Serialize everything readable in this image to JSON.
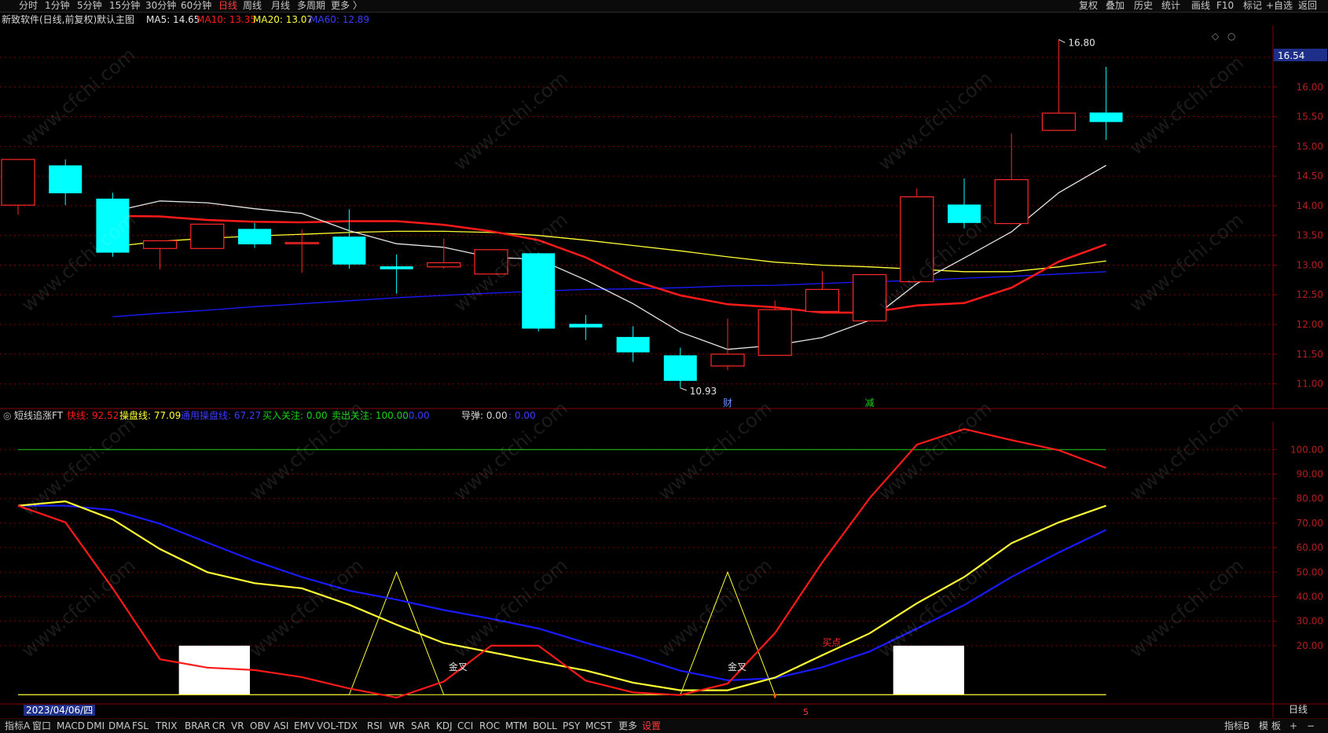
{
  "top_menu": {
    "periods": [
      "分时",
      "1分钟",
      "5分钟",
      "15分钟",
      "30分钟",
      "60分钟",
      "日线",
      "周线",
      "月线",
      "多周期",
      "更多 〉"
    ],
    "active_period": "日线",
    "right_items": [
      "复权",
      "叠加",
      "历史",
      "统计",
      "画线",
      "F10",
      "标记",
      "+自选",
      "返回"
    ]
  },
  "main_info": {
    "title": "新致软件(日线,前复权)",
    "template": "默认主图",
    "ma5": "MA5: 14.65",
    "ma10": "MA10: 13.35",
    "ma20": "MA20: 13.07",
    "ma60": "MA60: 12.89"
  },
  "sub_info": {
    "title": "短线追涨FT",
    "fast": "快线: 92.52",
    "control": "操盘线: 77.09",
    "general": "通用操盘线: 67.27",
    "buy_watch": "买入关注: 0.00",
    "sell_watch": "卖出关注: 100.00",
    "extra1": ": 0.00",
    "guide": "导弹: 0.00",
    "extra2": ": 0.00"
  },
  "colors": {
    "up": "#ff2828",
    "down": "#00ffff",
    "ma5": "#e6e6e6",
    "ma10": "#ff1a1a",
    "ma20": "#ffff33",
    "ma60": "#1a1aff",
    "grid": "#7a0000",
    "fast": "#ff1a1a",
    "control": "#ffff33",
    "general": "#1a1aff",
    "upper_line": "#19d219"
  },
  "current_price_tag": "16.54",
  "date_label": "2023/04/06/四",
  "watermark": "www.cfchi.com",
  "chart_data": [
    {
      "type": "candlestick",
      "name": "price",
      "y_ticks": [
        16.5,
        16.0,
        15.5,
        15.0,
        14.5,
        14.0,
        13.5,
        13.0,
        12.5,
        12.0,
        11.5,
        11.0
      ],
      "y_tick_labels": [
        "16.50",
        "16.00",
        "15.50",
        "15.00",
        "14.50",
        "14.00",
        "13.50",
        "13.00",
        "12.50",
        "12.00",
        "11.50",
        "11.00"
      ],
      "ylim": [
        10.69,
        16.91
      ],
      "candles": [
        {
          "o": 14.01,
          "h": 14.43,
          "l": 13.85,
          "c": 14.78
        },
        {
          "o": 14.68,
          "h": 14.78,
          "l": 14.01,
          "c": 14.21
        },
        {
          "o": 14.12,
          "h": 14.22,
          "l": 13.14,
          "c": 13.21
        },
        {
          "o": 13.28,
          "h": 13.41,
          "l": 12.93,
          "c": 13.41
        },
        {
          "o": 13.28,
          "h": 13.69,
          "l": 13.28,
          "c": 13.69
        },
        {
          "o": 13.61,
          "h": 13.71,
          "l": 13.29,
          "c": 13.35
        },
        {
          "o": 13.38,
          "h": 13.6,
          "l": 12.87,
          "c": 13.38
        },
        {
          "o": 13.48,
          "h": 13.94,
          "l": 12.94,
          "c": 13.01
        },
        {
          "o": 12.98,
          "h": 13.18,
          "l": 12.52,
          "c": 12.93
        },
        {
          "o": 12.97,
          "h": 13.45,
          "l": 12.94,
          "c": 13.04
        },
        {
          "o": 12.85,
          "h": 13.26,
          "l": 12.85,
          "c": 13.26
        },
        {
          "o": 13.2,
          "h": 13.21,
          "l": 11.88,
          "c": 11.93
        },
        {
          "o": 12.01,
          "h": 12.16,
          "l": 11.74,
          "c": 11.95
        },
        {
          "o": 11.79,
          "h": 11.97,
          "l": 11.37,
          "c": 11.53
        },
        {
          "o": 11.48,
          "h": 11.61,
          "l": 10.93,
          "c": 11.05
        },
        {
          "o": 11.3,
          "h": 12.1,
          "l": 11.23,
          "c": 11.5
        },
        {
          "o": 11.48,
          "h": 12.4,
          "l": 11.48,
          "c": 12.25
        },
        {
          "o": 12.22,
          "h": 12.9,
          "l": 12.22,
          "c": 12.59
        },
        {
          "o": 12.06,
          "h": 12.83,
          "l": 12.06,
          "c": 12.84
        },
        {
          "o": 12.72,
          "h": 14.29,
          "l": 12.72,
          "c": 14.15
        },
        {
          "o": 14.02,
          "h": 14.46,
          "l": 13.62,
          "c": 13.71
        },
        {
          "o": 13.7,
          "h": 15.22,
          "l": 13.7,
          "c": 14.44
        },
        {
          "o": 15.27,
          "h": 16.8,
          "l": 15.27,
          "c": 15.56
        },
        {
          "o": 15.57,
          "h": 16.34,
          "l": 15.11,
          "c": 15.41
        }
      ],
      "ma5": [
        13.9,
        14.08,
        14.05,
        13.95,
        13.87,
        13.58,
        13.36,
        13.3,
        13.13,
        13.1,
        12.75,
        12.35,
        11.87,
        11.58,
        11.65,
        11.78,
        12.07,
        12.69,
        13.12,
        13.56,
        14.22,
        14.68
      ],
      "ma10": [
        13.83,
        13.82,
        13.76,
        13.73,
        13.72,
        13.74,
        13.74,
        13.68,
        13.57,
        13.42,
        13.13,
        12.74,
        12.49,
        12.34,
        12.29,
        12.2,
        12.2,
        12.32,
        12.36,
        12.62,
        13.06,
        13.35
      ],
      "ma20": [
        13.31,
        13.4,
        13.45,
        13.49,
        13.52,
        13.55,
        13.57,
        13.57,
        13.55,
        13.5,
        13.42,
        13.33,
        13.24,
        13.14,
        13.05,
        13.0,
        12.97,
        12.93,
        12.89,
        12.89,
        12.97,
        13.07
      ],
      "ma60": [
        12.13,
        12.19,
        12.24,
        12.3,
        12.35,
        12.4,
        12.45,
        12.49,
        12.53,
        12.56,
        12.59,
        12.6,
        12.62,
        12.65,
        12.66,
        12.69,
        12.72,
        12.74,
        12.78,
        12.81,
        12.85,
        12.89
      ],
      "annotations": [
        {
          "text": "16.80",
          "at": 22
        },
        {
          "text": "10.93",
          "at": 14
        },
        {
          "text": "财",
          "at": 15
        },
        {
          "text": "减",
          "at": 18
        }
      ]
    },
    {
      "type": "line",
      "name": "indicator",
      "y_ticks": [
        100,
        90,
        80,
        70,
        60,
        50,
        40,
        30,
        20
      ],
      "y_tick_labels": [
        "100.00",
        "90.00",
        "80.00",
        "70.00",
        "60.00",
        "50.00",
        "40.00",
        "30.00",
        "20.00"
      ],
      "ylim": [
        -2.8,
        111.3
      ],
      "series": [
        {
          "name": "快线",
          "values": [
            77.09,
            70.34,
            43.42,
            14.46,
            11.05,
            10.04,
            7.17,
            2.56,
            -1.17,
            5.36,
            20.03,
            20.03,
            5.73,
            0.96,
            -0.13,
            4.53,
            25.14,
            54.0,
            80.16,
            102.04,
            108.37,
            103.88,
            99.73,
            92.52
          ]
        },
        {
          "name": "操盘线",
          "values": [
            77.09,
            78.9,
            71.52,
            59.41,
            50.0,
            45.49,
            43.42,
            36.72,
            28.57,
            21.09,
            17.34,
            13.52,
            9.88,
            4.91,
            1.81,
            1.81,
            6.99,
            16.1,
            25.03,
            37.3,
            47.99,
            61.8,
            70.3,
            77.09
          ]
        },
        {
          "name": "通用操盘线",
          "values": [
            77.09,
            77.09,
            75.35,
            69.73,
            62.07,
            54.53,
            47.99,
            42.44,
            38.8,
            34.55,
            30.97,
            27.02,
            21.18,
            15.84,
            9.78,
            5.89,
            6.72,
            11.21,
            17.61,
            26.99,
            36.55,
            48.03,
            58.04,
            67.27
          ]
        },
        {
          "name": "金叉标记",
          "values": [
            0,
            0,
            0,
            0,
            0,
            0,
            0,
            0,
            50,
            0,
            0,
            0,
            0,
            0,
            0,
            50,
            0,
            0,
            0,
            0,
            0,
            0,
            0,
            0
          ]
        }
      ],
      "upper_level": 100,
      "lower_level": 0,
      "blocks": [
        {
          "from": 3.4,
          "to": 4.9,
          "top": 20
        },
        {
          "from": 18.5,
          "to": 20.0,
          "top": 20
        }
      ],
      "annotations": [
        {
          "text": "金叉",
          "at": 9.3,
          "y": 10
        },
        {
          "text": "金叉",
          "at": 15.2,
          "y": 10
        },
        {
          "text": "买点",
          "at": 17.2,
          "y": 20
        }
      ]
    }
  ],
  "bottom_tabs": [
    "指标A",
    "窗口",
    "MACD",
    "DMI",
    "DMA",
    "FSL",
    "TRIX",
    "BRAR",
    "CR",
    "VR",
    "OBV",
    "ASI",
    "EMV",
    "VOL-TDX",
    "RSI",
    "WR",
    "SAR",
    "KDJ",
    "CCI",
    "ROC",
    "MTM",
    "BOLL",
    "PSY",
    "MCST",
    "更多",
    "设置"
  ],
  "bottom_right": [
    "指标B",
    "模",
    "板",
    "+",
    "−"
  ],
  "period_label": "日线"
}
